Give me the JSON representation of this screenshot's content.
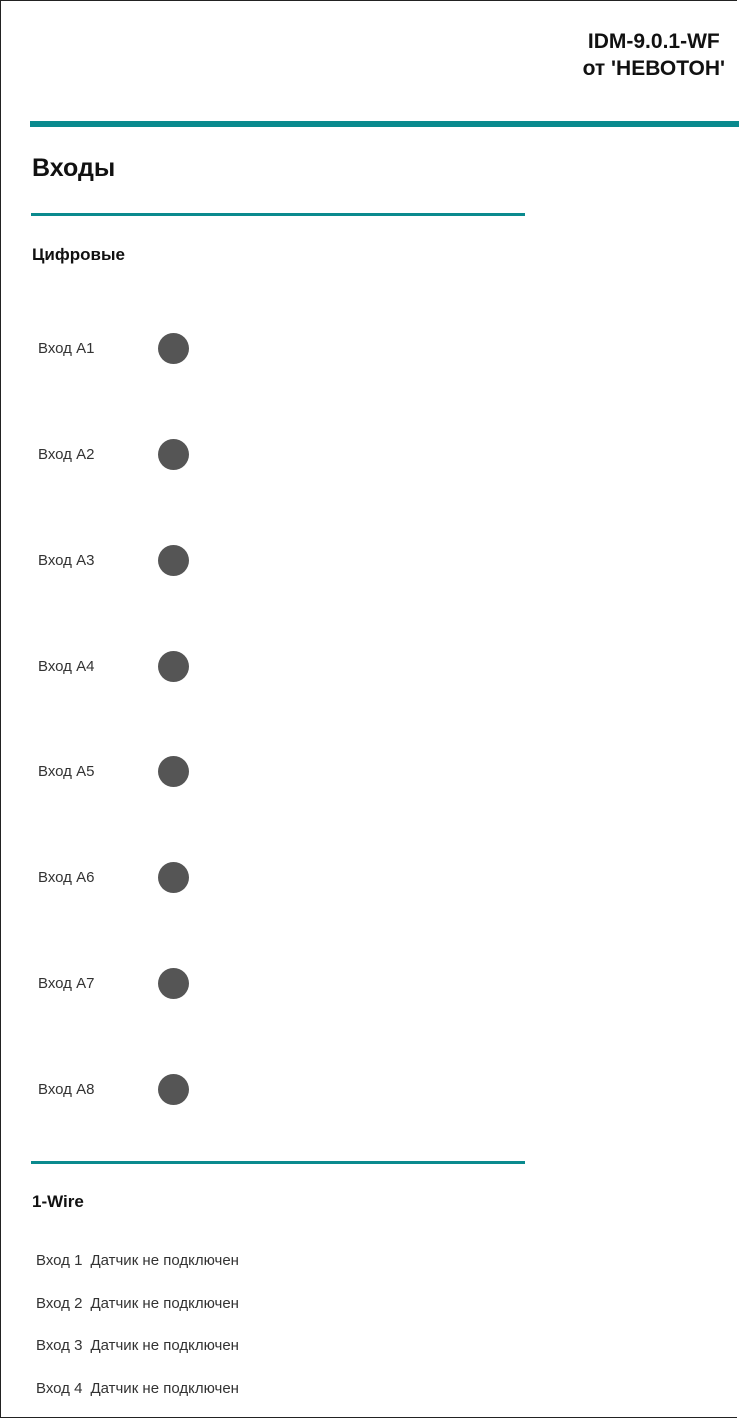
{
  "header": {
    "line1": "IDM-9.0.1-WF",
    "line2": "от 'НЕВОТОН'"
  },
  "page_title": "Входы",
  "digital": {
    "title": "Цифровые",
    "indicator_color": "#555555",
    "inputs": [
      {
        "label": "Вход А1"
      },
      {
        "label": "Вход А2"
      },
      {
        "label": "Вход А3"
      },
      {
        "label": "Вход А4"
      },
      {
        "label": "Вход А5"
      },
      {
        "label": "Вход А6"
      },
      {
        "label": "Вход А7"
      },
      {
        "label": "Вход А8"
      }
    ]
  },
  "onewire": {
    "title": "1-Wire",
    "inputs": [
      {
        "label": "Вход 1",
        "status": "Датчик не подключен"
      },
      {
        "label": "Вход 2",
        "status": "Датчик не подключен"
      },
      {
        "label": "Вход 3",
        "status": "Датчик не подключен"
      },
      {
        "label": "Вход 4",
        "status": "Датчик не подключен"
      }
    ]
  },
  "colors": {
    "accent": "#0a8a8e"
  }
}
